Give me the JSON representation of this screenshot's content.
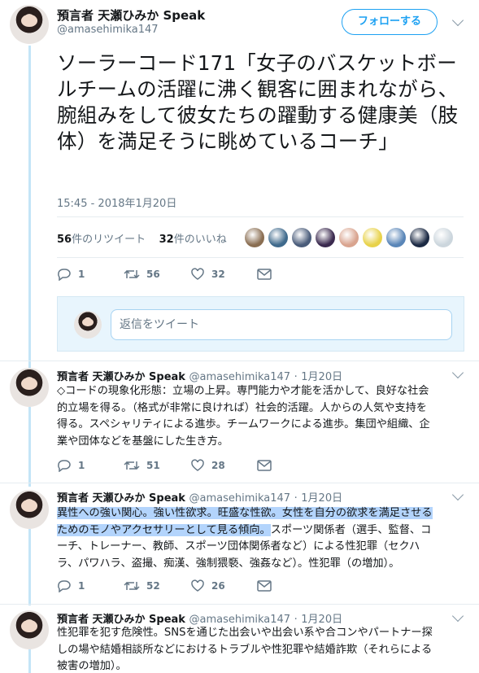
{
  "main": {
    "name": "預言者 天瀬ひみか Speak",
    "handle": "@amasehimika147",
    "follow_label": "フォローする",
    "text": "ソーラーコード171「女子のバスケットボールチームの活躍に沸く観客に囲まれながら、腕組みをして彼女たちの躍動する健康美（肢体）を満足そうに眺めているコーチ」",
    "time": "15:45 - 2018年1月20日",
    "retweets_count": "56",
    "retweets_label": "件のリツイート",
    "likes_count": "32",
    "likes_label": "件のいいね",
    "liker_colors": [
      "#8a6e52",
      "#3f6a8c",
      "#4a5c7a",
      "#3b2a4f",
      "#d9a48f",
      "#e8d24a",
      "#5a86b8",
      "#1c2a44",
      "#ccd6dd"
    ],
    "actions": {
      "reply": "1",
      "retweet": "56",
      "like": "32"
    },
    "reply_placeholder": "返信をツイート"
  },
  "replies": [
    {
      "name": "預言者 天瀬ひみか Speak",
      "handle": "@amasehimika147",
      "date": "1月20日",
      "text_lines": [
        "◇コードの現象化形態：立場の上昇。専門能力や才能を活かして、良好な社会",
        "的立場を得る。（格式が非常に良ければ）社会的活躍。人からの人気や支持を",
        "得る。スペシャリティによる進歩。チームワークによる進歩。集団や組織、企",
        "業や団体などを基盤にした生き方。"
      ],
      "actions": {
        "reply": "1",
        "retweet": "51",
        "like": "28"
      }
    },
    {
      "name": "預言者 天瀬ひみか Speak",
      "handle": "@amasehimika147",
      "date": "1月20日",
      "highlight_lines": [
        "異性への強い関心。強い性欲求。旺盛な性欲。女性を自分の欲求を満足させる",
        "ためのモノやアクセサリーとして見る傾向。"
      ],
      "text_tail": "スポーツ関係者（選手、監督、コ",
      "text_lines": [
        "ーチ、トレーナー、教師、スポーツ団体関係者など）による性犯罪（セクハ",
        "ラ、パワハラ、盗撮、痴漢、強制猥褻、強姦など）。性犯罪（の増加）。"
      ],
      "actions": {
        "reply": "1",
        "retweet": "52",
        "like": "26"
      }
    },
    {
      "name": "預言者 天瀬ひみか Speak",
      "handle": "@amasehimika147",
      "date": "1月20日",
      "text_lines": [
        "性犯罪を犯す危険性。SNSを通じた出会いや出会い系や合コンやパートナー探",
        "しの場や結婚相談所などにおけるトラブルや性犯罪や結婚詐欺（それらによる",
        "被害の増加）。"
      ]
    }
  ]
}
